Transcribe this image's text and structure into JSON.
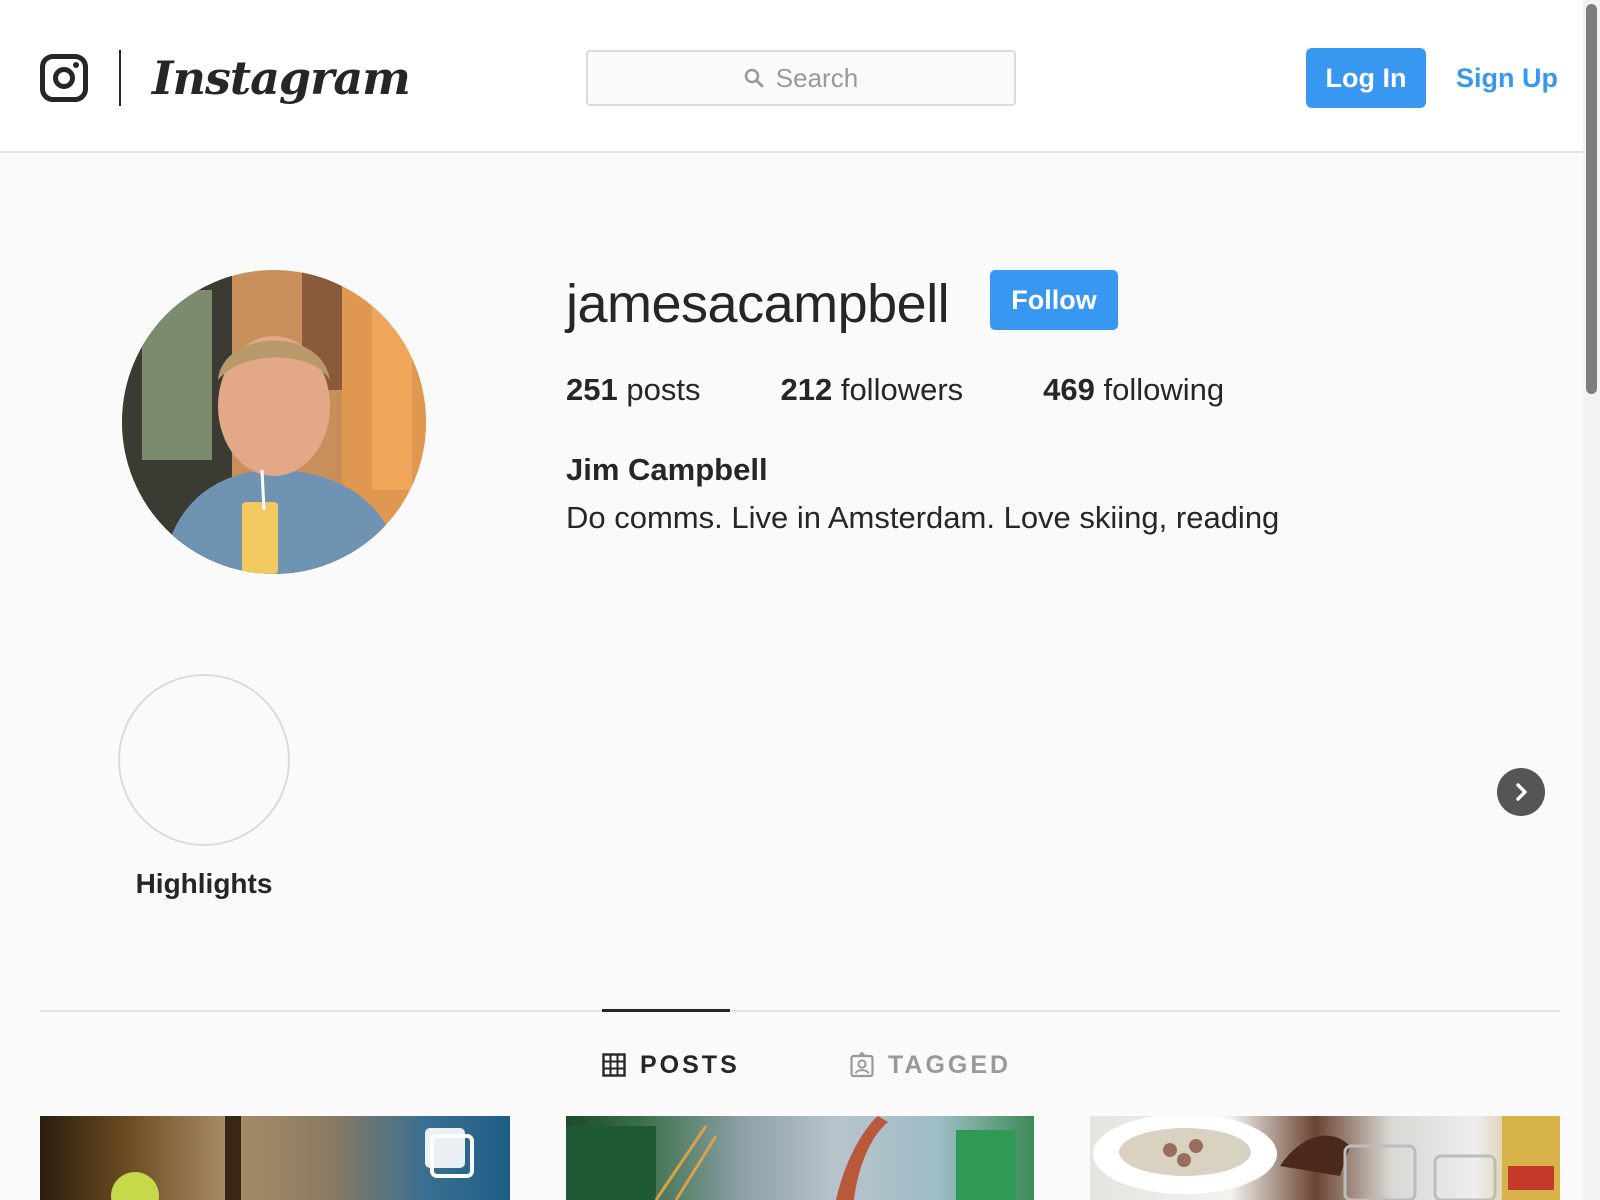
{
  "header": {
    "wordmark": "Instagram",
    "search_placeholder": "Search",
    "login_label": "Log In",
    "signup_label": "Sign Up"
  },
  "profile": {
    "username": "jamesacampbell",
    "follow_label": "Follow",
    "stats": [
      {
        "count": "251",
        "label": "posts"
      },
      {
        "count": "212",
        "label": "followers"
      },
      {
        "count": "469",
        "label": "following"
      }
    ],
    "full_name": "Jim Campbell",
    "bio": "Do comms. Live in Amsterdam. Love skiing, reading"
  },
  "highlights": {
    "items": [
      {
        "label": "Highlights"
      }
    ],
    "next_icon": "chevron-right-icon"
  },
  "tabs": [
    {
      "label": "POSTS",
      "icon": "grid-icon",
      "active": true
    },
    {
      "label": "TAGGED",
      "icon": "tagged-person-icon",
      "active": false
    }
  ],
  "posts": [
    {
      "type": "carousel",
      "icon": "multiple-photos-icon"
    },
    {
      "type": "photo"
    },
    {
      "type": "photo"
    }
  ],
  "colors": {
    "accent": "#3897f0",
    "text": "#262626",
    "muted": "#999999",
    "background": "#fafafa",
    "border": "#dbdbdb"
  }
}
